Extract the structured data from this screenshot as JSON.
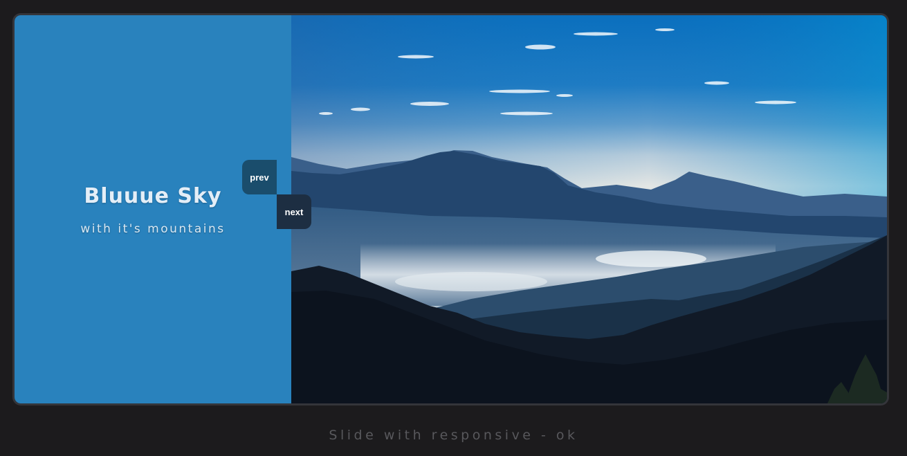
{
  "slide": {
    "title": "Bluuue Sky",
    "subtitle": "with it's mountains",
    "panel_color": "#2982bd",
    "image_alt": "mountain-landscape"
  },
  "nav": {
    "prev_label": "prev",
    "next_label": "next"
  },
  "caption": "Slide with responsive - ok",
  "colors": {
    "page_background": "#1c1b1d",
    "frame_border": "#34353a",
    "prev_button": "#1a4d6c",
    "next_button": "#1d2e42",
    "caption_text": "#58585c"
  }
}
